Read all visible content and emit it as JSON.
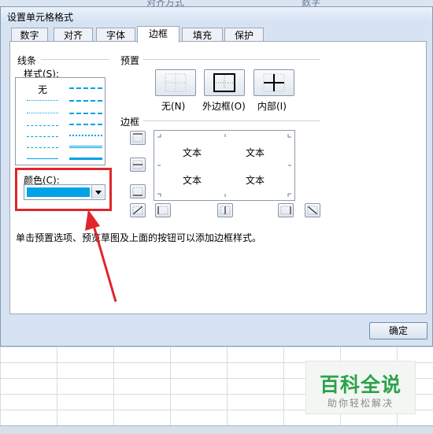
{
  "background": {
    "top_header_text": "对齐方式",
    "top_header_text2": "数字"
  },
  "dialog": {
    "title": "设置单元格格式",
    "tabs": [
      {
        "label": "数字"
      },
      {
        "label": "对齐"
      },
      {
        "label": "字体"
      },
      {
        "label": "边框",
        "active": true
      },
      {
        "label": "填充"
      },
      {
        "label": "保护"
      }
    ],
    "line_section": {
      "title": "线条",
      "style_label": "样式(S):",
      "none_label": "无",
      "color_label": "颜色(C):",
      "color_value": "#00a2e8"
    },
    "presets": {
      "title": "预置",
      "items": [
        {
          "label": "无(N)"
        },
        {
          "label": "外边框(O)"
        },
        {
          "label": "内部(I)"
        }
      ]
    },
    "border": {
      "title": "边框",
      "preview_text": [
        "文本",
        "文本",
        "文本",
        "文本"
      ]
    },
    "hint": "单击预置选项、预览草图及上面的按钮可以添加边框样式。",
    "ok_label": "确定"
  },
  "watermark": {
    "title": "百科全说",
    "subtitle": "助你轻松解决"
  },
  "colors": {
    "accent": "#00a2e8",
    "highlight": "#e0262c",
    "dialog_bg": "#d7e3f2"
  }
}
